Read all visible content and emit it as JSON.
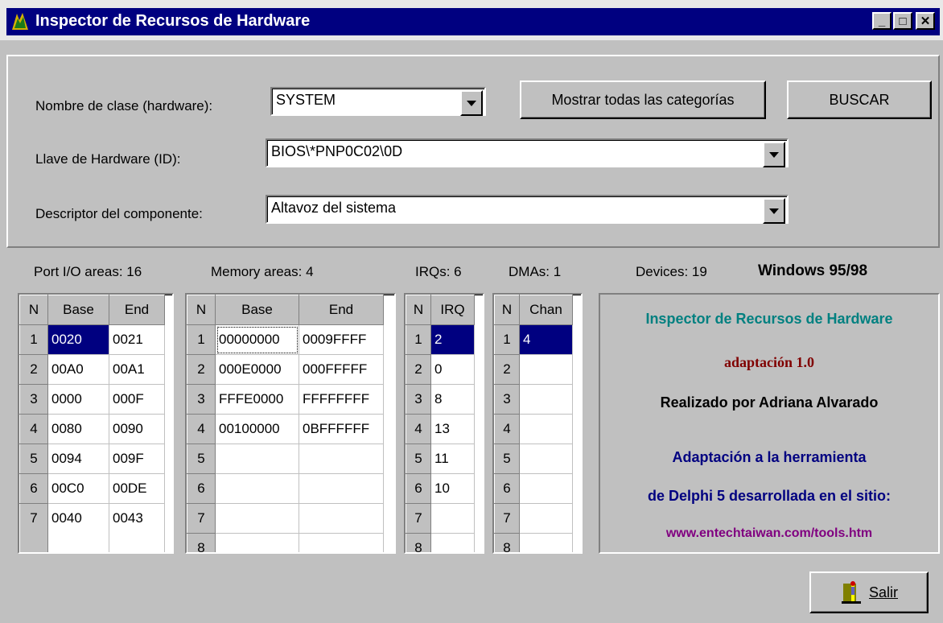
{
  "window": {
    "title": "Inspector de Recursos de Hardware"
  },
  "caption": {
    "min": "_",
    "max": "□",
    "close": "✕"
  },
  "form": {
    "class_label": "Nombre de clase (hardware):",
    "class_value": "SYSTEM",
    "key_label": "Llave de Hardware (ID):",
    "key_value": "BIOS\\*PNP0C02\\0D",
    "descriptor_label": "Descriptor del componente:",
    "descriptor_value": "Altavoz del sistema",
    "show_all_button": "Mostrar todas las categorías",
    "search_button": "BUSCAR"
  },
  "stats": {
    "ports": "Port I/O areas: 16",
    "memory": "Memory areas: 4",
    "irqs": "IRQs: 6",
    "dmas": "DMAs: 1",
    "devices": "Devices: 19",
    "os": "Windows 95/98"
  },
  "ports": {
    "headers": [
      "N",
      "Base",
      "End"
    ],
    "rows": [
      [
        "1",
        "0020",
        "0021"
      ],
      [
        "2",
        "00A0",
        "00A1"
      ],
      [
        "3",
        "0000",
        "000F"
      ],
      [
        "4",
        "0080",
        "0090"
      ],
      [
        "5",
        "0094",
        "009F"
      ],
      [
        "6",
        "00C0",
        "00DE"
      ],
      [
        "7",
        "0040",
        "0043"
      ]
    ]
  },
  "memory": {
    "headers": [
      "N",
      "Base",
      "End"
    ],
    "rows": [
      [
        "1",
        "00000000",
        "0009FFFF"
      ],
      [
        "2",
        "000E0000",
        "000FFFFF"
      ],
      [
        "3",
        "FFFE0000",
        "FFFFFFFF"
      ],
      [
        "4",
        "00100000",
        "0BFFFFFF"
      ],
      [
        "5",
        "",
        ""
      ],
      [
        "6",
        "",
        ""
      ],
      [
        "7",
        "",
        ""
      ],
      [
        "8",
        "",
        ""
      ]
    ]
  },
  "irqs": {
    "headers": [
      "N",
      "IRQ"
    ],
    "rows": [
      [
        "1",
        "2"
      ],
      [
        "2",
        "0"
      ],
      [
        "3",
        "8"
      ],
      [
        "4",
        "13"
      ],
      [
        "5",
        "11"
      ],
      [
        "6",
        "10"
      ],
      [
        "7",
        ""
      ],
      [
        "8",
        ""
      ]
    ]
  },
  "dmas": {
    "headers": [
      "N",
      "Chan"
    ],
    "rows": [
      [
        "1",
        "4"
      ],
      [
        "2",
        ""
      ],
      [
        "3",
        ""
      ],
      [
        "4",
        ""
      ],
      [
        "5",
        ""
      ],
      [
        "6",
        ""
      ],
      [
        "7",
        ""
      ],
      [
        "8",
        ""
      ]
    ]
  },
  "info": {
    "title": "Inspector de Recursos de Hardware",
    "version": "adaptación 1.0",
    "author": "Realizado por Adriana Alvarado",
    "line1": "Adaptación a la herramienta",
    "line2": "de Delphi 5 desarrollada en el sitio:",
    "url": "www.entechtaiwan.com/tools.htm"
  },
  "exit_button": "Salir",
  "colors": {
    "titlebar": "#000080",
    "teal": "#008080",
    "maroon": "#800000",
    "navy": "#000080",
    "purple": "#800080"
  }
}
